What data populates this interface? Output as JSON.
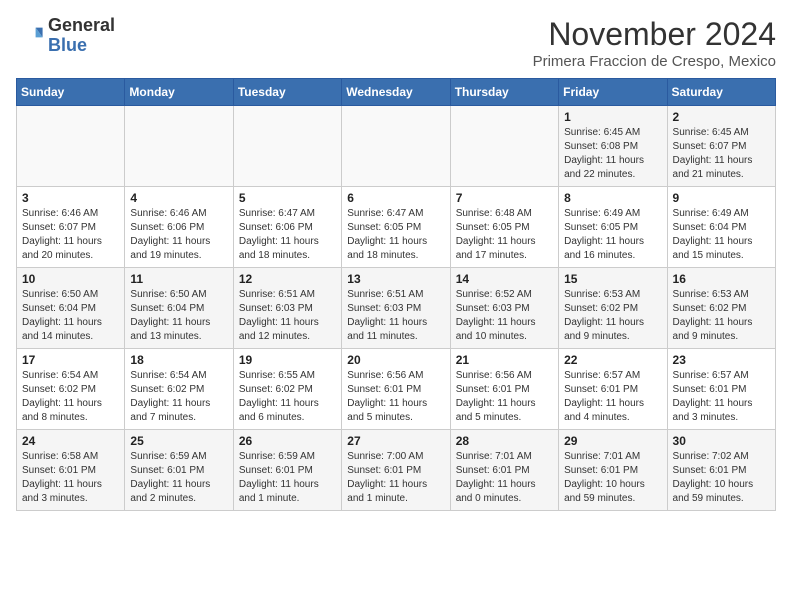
{
  "header": {
    "logo_general": "General",
    "logo_blue": "Blue",
    "month_title": "November 2024",
    "location": "Primera Fraccion de Crespo, Mexico"
  },
  "weekdays": [
    "Sunday",
    "Monday",
    "Tuesday",
    "Wednesday",
    "Thursday",
    "Friday",
    "Saturday"
  ],
  "weeks": [
    [
      {
        "day": "",
        "info": ""
      },
      {
        "day": "",
        "info": ""
      },
      {
        "day": "",
        "info": ""
      },
      {
        "day": "",
        "info": ""
      },
      {
        "day": "",
        "info": ""
      },
      {
        "day": "1",
        "info": "Sunrise: 6:45 AM\nSunset: 6:08 PM\nDaylight: 11 hours and 22 minutes."
      },
      {
        "day": "2",
        "info": "Sunrise: 6:45 AM\nSunset: 6:07 PM\nDaylight: 11 hours and 21 minutes."
      }
    ],
    [
      {
        "day": "3",
        "info": "Sunrise: 6:46 AM\nSunset: 6:07 PM\nDaylight: 11 hours and 20 minutes."
      },
      {
        "day": "4",
        "info": "Sunrise: 6:46 AM\nSunset: 6:06 PM\nDaylight: 11 hours and 19 minutes."
      },
      {
        "day": "5",
        "info": "Sunrise: 6:47 AM\nSunset: 6:06 PM\nDaylight: 11 hours and 18 minutes."
      },
      {
        "day": "6",
        "info": "Sunrise: 6:47 AM\nSunset: 6:05 PM\nDaylight: 11 hours and 18 minutes."
      },
      {
        "day": "7",
        "info": "Sunrise: 6:48 AM\nSunset: 6:05 PM\nDaylight: 11 hours and 17 minutes."
      },
      {
        "day": "8",
        "info": "Sunrise: 6:49 AM\nSunset: 6:05 PM\nDaylight: 11 hours and 16 minutes."
      },
      {
        "day": "9",
        "info": "Sunrise: 6:49 AM\nSunset: 6:04 PM\nDaylight: 11 hours and 15 minutes."
      }
    ],
    [
      {
        "day": "10",
        "info": "Sunrise: 6:50 AM\nSunset: 6:04 PM\nDaylight: 11 hours and 14 minutes."
      },
      {
        "day": "11",
        "info": "Sunrise: 6:50 AM\nSunset: 6:04 PM\nDaylight: 11 hours and 13 minutes."
      },
      {
        "day": "12",
        "info": "Sunrise: 6:51 AM\nSunset: 6:03 PM\nDaylight: 11 hours and 12 minutes."
      },
      {
        "day": "13",
        "info": "Sunrise: 6:51 AM\nSunset: 6:03 PM\nDaylight: 11 hours and 11 minutes."
      },
      {
        "day": "14",
        "info": "Sunrise: 6:52 AM\nSunset: 6:03 PM\nDaylight: 11 hours and 10 minutes."
      },
      {
        "day": "15",
        "info": "Sunrise: 6:53 AM\nSunset: 6:02 PM\nDaylight: 11 hours and 9 minutes."
      },
      {
        "day": "16",
        "info": "Sunrise: 6:53 AM\nSunset: 6:02 PM\nDaylight: 11 hours and 9 minutes."
      }
    ],
    [
      {
        "day": "17",
        "info": "Sunrise: 6:54 AM\nSunset: 6:02 PM\nDaylight: 11 hours and 8 minutes."
      },
      {
        "day": "18",
        "info": "Sunrise: 6:54 AM\nSunset: 6:02 PM\nDaylight: 11 hours and 7 minutes."
      },
      {
        "day": "19",
        "info": "Sunrise: 6:55 AM\nSunset: 6:02 PM\nDaylight: 11 hours and 6 minutes."
      },
      {
        "day": "20",
        "info": "Sunrise: 6:56 AM\nSunset: 6:01 PM\nDaylight: 11 hours and 5 minutes."
      },
      {
        "day": "21",
        "info": "Sunrise: 6:56 AM\nSunset: 6:01 PM\nDaylight: 11 hours and 5 minutes."
      },
      {
        "day": "22",
        "info": "Sunrise: 6:57 AM\nSunset: 6:01 PM\nDaylight: 11 hours and 4 minutes."
      },
      {
        "day": "23",
        "info": "Sunrise: 6:57 AM\nSunset: 6:01 PM\nDaylight: 11 hours and 3 minutes."
      }
    ],
    [
      {
        "day": "24",
        "info": "Sunrise: 6:58 AM\nSunset: 6:01 PM\nDaylight: 11 hours and 3 minutes."
      },
      {
        "day": "25",
        "info": "Sunrise: 6:59 AM\nSunset: 6:01 PM\nDaylight: 11 hours and 2 minutes."
      },
      {
        "day": "26",
        "info": "Sunrise: 6:59 AM\nSunset: 6:01 PM\nDaylight: 11 hours and 1 minute."
      },
      {
        "day": "27",
        "info": "Sunrise: 7:00 AM\nSunset: 6:01 PM\nDaylight: 11 hours and 1 minute."
      },
      {
        "day": "28",
        "info": "Sunrise: 7:01 AM\nSunset: 6:01 PM\nDaylight: 11 hours and 0 minutes."
      },
      {
        "day": "29",
        "info": "Sunrise: 7:01 AM\nSunset: 6:01 PM\nDaylight: 10 hours and 59 minutes."
      },
      {
        "day": "30",
        "info": "Sunrise: 7:02 AM\nSunset: 6:01 PM\nDaylight: 10 hours and 59 minutes."
      }
    ]
  ]
}
